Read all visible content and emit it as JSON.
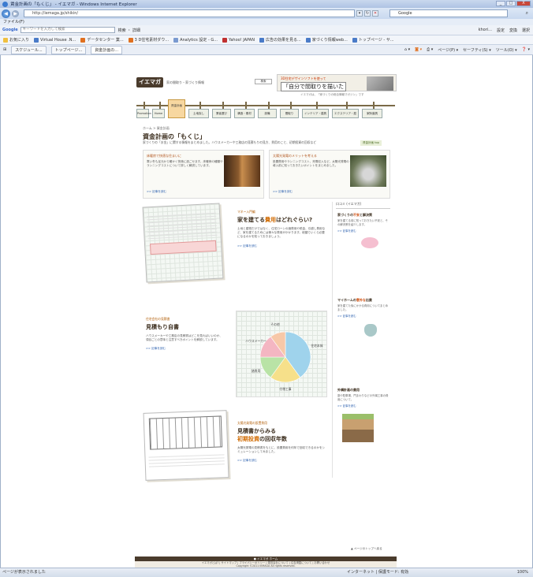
{
  "window": {
    "title": "賃金計画の「もくじ」 - イエマガ - Windows Internet Explorer",
    "minimize": "_",
    "maximize": "□",
    "close": "X"
  },
  "address": {
    "url": "http://iemaga.jp/shikin/",
    "search_placeholder": "Google"
  },
  "menubar": {
    "text": "ファイル(F)"
  },
  "googlebar": {
    "logo": "Google",
    "placeholder": "キーワードを入力して検索",
    "search_btn": "検索 ・ 詳細",
    "right": [
      "khori...",
      "設定",
      "変換",
      "選択"
    ]
  },
  "favorites": [
    {
      "label": "お気に入り",
      "color": "#f0c040"
    },
    {
      "label": "Virtual House .N...",
      "color": "#4a7bc8"
    },
    {
      "label": "データセンター 業...",
      "color": "#e07020"
    },
    {
      "label": "3 D住宅素材ダウ...",
      "color": "#e07020"
    },
    {
      "label": "Analytics 設定 - G...",
      "color": "#7a9ad0"
    },
    {
      "label": "Yahoo! JAPAN",
      "color": "#c03030"
    },
    {
      "label": "広告の効果を見る...",
      "color": "#4a7bc8"
    },
    {
      "label": "家づくり情報web...",
      "color": "#4a7bc8"
    },
    {
      "label": "トップページ - サ...",
      "color": "#4a7bc8"
    }
  ],
  "tabs": [
    {
      "label": "スケジュール..."
    },
    {
      "label": "トップページ..."
    },
    {
      "label": "資金計画の..."
    }
  ],
  "commandbar": [
    "ページ(P) ▾",
    "セーフティ(S) ▾",
    "ツール(O) ▾"
  ],
  "status": {
    "left": "ページが表示されました",
    "zone": "インターネット | 保護モード: 有効",
    "zoom": "100%"
  },
  "site": {
    "logo": "イエマガ",
    "tagline": "家の間取り・家づくり情報",
    "search_label": "検索",
    "banner_small": "3D住宅デザインソフトを使って",
    "banner_big": "「自分で間取りを描いた",
    "subnote": "イエマガは、「家づくりの総合情報マガジン」です",
    "nav": [
      {
        "label": "Promotion"
      },
      {
        "label": "Home"
      },
      {
        "label": "資金計画"
      },
      {
        "label": "土地探し"
      },
      {
        "label": "業者選び"
      },
      {
        "label": "構造・素材"
      },
      {
        "label": "設備"
      },
      {
        "label": "間取り"
      },
      {
        "label": "インテリア・建具"
      },
      {
        "label": "エクステリア・庭"
      },
      {
        "label": "家財道具"
      }
    ],
    "breadcrumb": "ホーム > 資金計画",
    "intro_title": "資金計画の「もくじ」",
    "intro_text": "家づくりの「お金」に関する情報をまとめました。ハウスメーカーや工務店の見積もりの見方、費用のこと、初期投資の回収など",
    "intro_tag": "資金計画 top",
    "features": [
      {
        "title": "床暖房で快適な住まいに",
        "body": "寒い冬も足元から暖かく快適に過ごせます。床暖房の種類やランニングコストについて詳しく解説しています。",
        "link": ">> 記事を読む"
      },
      {
        "title": "太陽光発電のメリットを考える",
        "body": "設置費用やランニングコスト、売電収入など、太陽光発電の導入前に知っておきたいポイントをまとめました。",
        "link": ">> 記事を読む"
      }
    ],
    "s1": {
      "eyebrow": "マネー入門編",
      "head_a": "家を建てる",
      "head_em": "費用",
      "head_b": "はどれぐらい?",
      "body": "土地と建物だけではなく、住宅ローンの諸費用や税金、引越し費用など、家を建てるためには様々な費用がかかります。総額でいくら必要になるのかを知っておきましょう。",
      "more": ">> 記事を読む"
    },
    "s2": {
      "eyebrow": "住宅会社の見積書",
      "head": "見積もり自書",
      "body": "ハウスメーカーや工務店の見積書はどこを見ればいいのか、項目ごとの意味と注意すべきポイントを解説しています。",
      "more": ">> 記事を読む"
    },
    "s3": {
      "eyebrow": "太陽光発電の設置費用",
      "head_a": "見積書からみる",
      "head_b": "初期投資",
      "head_c": "の回収年数",
      "body": "太陽光発電の見積書をもとに、設置費用を何年で回収できるのかをシミュレーションしてみました。",
      "more": ">> 記事を読む"
    },
    "pie": {
      "labels": [
        "住宅本体",
        "付帯工事",
        "諸費用",
        "ハウスメーカー",
        "その他"
      ],
      "values": [
        40,
        20,
        15,
        15,
        10
      ],
      "colors": [
        "#9fd3ec",
        "#f6e08a",
        "#b9e3a6",
        "#f4b6c2",
        "#f7c8a8"
      ]
    },
    "sidebar": {
      "head": "口コミ (イエマガ)",
      "items": [
        {
          "title_a": "家づくりの",
          "title_em": "不安",
          "title_b": "と解決策",
          "body": "家を建てる前に知っておきたい不安と、その解決策を紹介します。",
          "link": ">> 記事を読む"
        },
        {
          "title_a": "マイホームの",
          "title_em": "意外な",
          "title_b": "出費",
          "body": "家を建てた後にかかる費用についてまとめました。",
          "link": ">> 記事を読む"
        },
        {
          "title_a": "外構",
          "title_em": "",
          "title_b": "計画の費用",
          "body": "庭や駐車場、門まわりなどの外構工事の費用について。",
          "link": ">> 記事を読む"
        }
      ]
    },
    "pagetop": "▲ ページのトップへ戻る",
    "footer_top": "● イエマガ ホーム",
    "footer_links": "イエマガとは? | サイトマップ | プライバシーポリシー | 運営会社について | 広告掲載について | お問い合わせ",
    "copyright": "Copyright ©2011 IEMAGA All rights reserved."
  }
}
